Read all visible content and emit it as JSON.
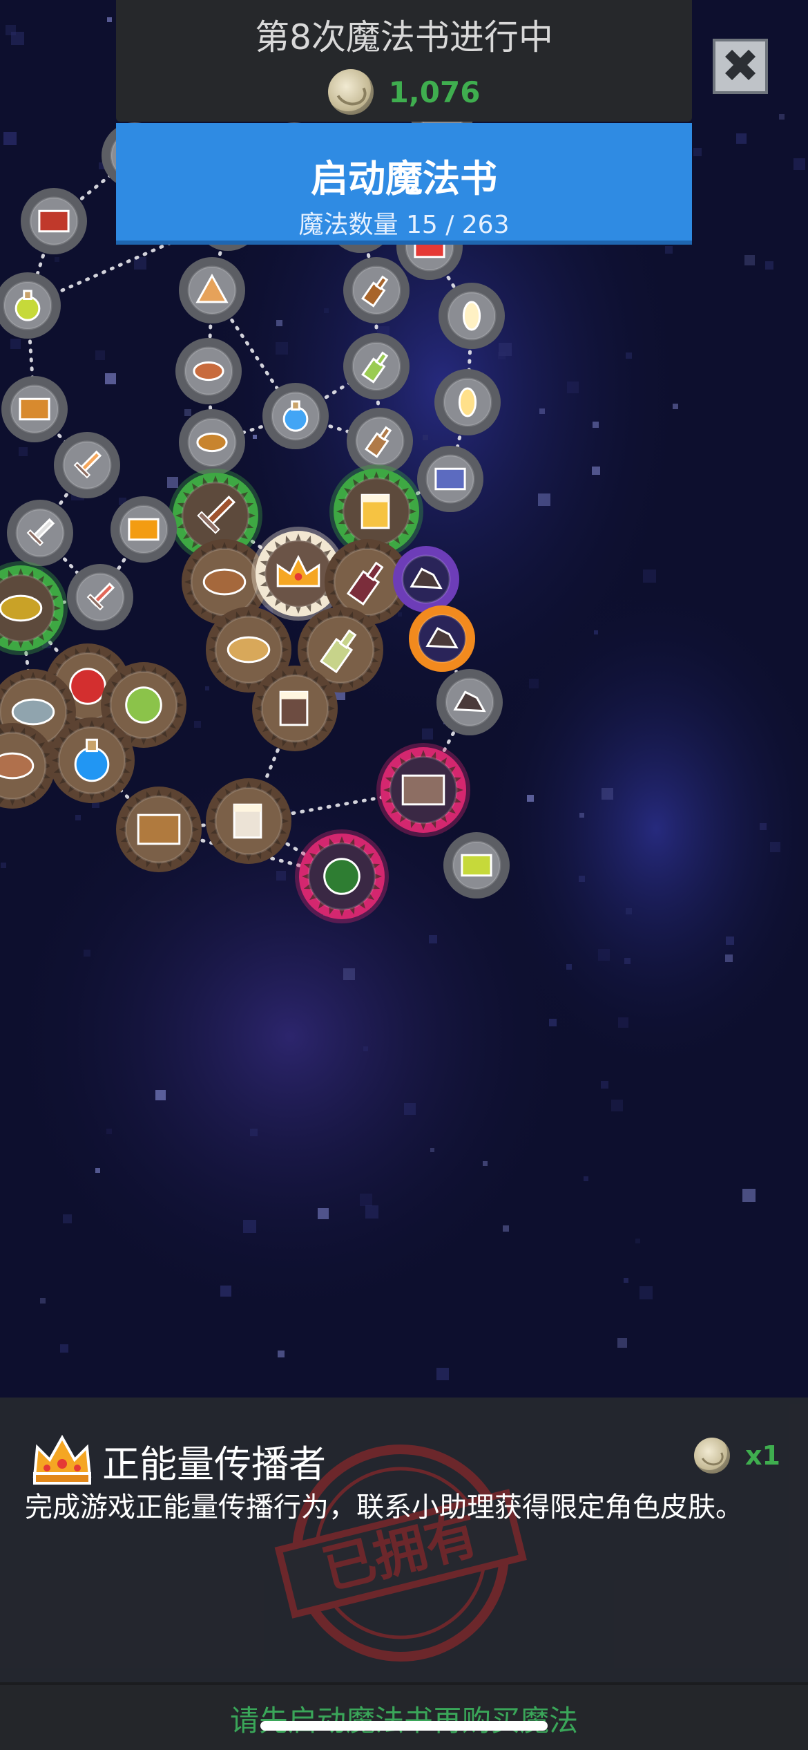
{
  "header": {
    "title": "第8次魔法书进行中",
    "coins": "1,076",
    "close_icon": "close-icon"
  },
  "start_button": {
    "label": "启动魔法书",
    "magic_count": "魔法数量 15 / 263"
  },
  "selected": {
    "icon": "crown-icon",
    "title": "正能量传播者",
    "cost_quantity": "x1",
    "description": "完成游戏正能量传播行为，联系小助理获得限定角色皮肤。",
    "stamp_text": "已拥有"
  },
  "footer": {
    "message": "请先启动魔法书再购买魔法"
  },
  "colors": {
    "background": "#0d0f2e",
    "accent_blue": "#2f8be3",
    "coin_green": "#3fae4f",
    "owned_bronze": "#6e5540",
    "active_green": "#3ea843",
    "rare_purple": "#6d3db8",
    "epic_orange": "#f28a1e",
    "legend_pink": "#d4276f",
    "locked_grey": "#77797f"
  },
  "nodes": [
    {
      "icon": "bacon-icon",
      "state": "locked"
    },
    {
      "icon": "onigiri-icon",
      "state": "locked"
    },
    {
      "icon": "bottle-icon",
      "state": "locked"
    },
    {
      "icon": "boot-icon",
      "state": "locked"
    },
    {
      "icon": "red-card-icon",
      "state": "locked"
    },
    {
      "icon": "potion-icon",
      "state": "locked"
    },
    {
      "icon": "pizza-icon",
      "state": "locked"
    },
    {
      "icon": "whiskey-icon",
      "state": "locked"
    },
    {
      "icon": "candle-icon",
      "state": "locked"
    },
    {
      "icon": "hotdog-icon",
      "state": "locked"
    },
    {
      "icon": "wine-bottle-icon",
      "state": "locked"
    },
    {
      "icon": "treasure-chest-icon",
      "state": "locked"
    },
    {
      "icon": "blue-potion-icon",
      "state": "locked"
    },
    {
      "icon": "lit-candle-icon",
      "state": "locked"
    },
    {
      "icon": "burger-icon",
      "state": "locked"
    },
    {
      "icon": "rum-bottle-icon",
      "state": "locked"
    },
    {
      "icon": "sword-icon",
      "state": "locked"
    },
    {
      "icon": "winged-boot-icon",
      "state": "locked"
    },
    {
      "icon": "kebab-icon",
      "state": "active"
    },
    {
      "icon": "beer-icon",
      "state": "active"
    },
    {
      "icon": "dagger-icon",
      "state": "locked"
    },
    {
      "icon": "battery-icon",
      "state": "locked"
    },
    {
      "icon": "steak-icon",
      "state": "owned"
    },
    {
      "icon": "crown-icon",
      "state": "selected"
    },
    {
      "icon": "wine-icon",
      "state": "owned"
    },
    {
      "icon": "ore-icon",
      "state": "rare"
    },
    {
      "icon": "slime-icon",
      "state": "active"
    },
    {
      "icon": "red-sword-icon",
      "state": "locked"
    },
    {
      "icon": "ore-icon",
      "state": "epic"
    },
    {
      "icon": "soup-icon",
      "state": "owned"
    },
    {
      "icon": "white-wine-icon",
      "state": "owned"
    },
    {
      "icon": "apple-icon",
      "state": "owned"
    },
    {
      "icon": "cabbage-icon",
      "state": "owned"
    },
    {
      "icon": "fish-icon",
      "state": "owned"
    },
    {
      "icon": "stout-icon",
      "state": "owned"
    },
    {
      "icon": "ore-icon",
      "state": "locked"
    },
    {
      "icon": "ham-icon",
      "state": "owned"
    },
    {
      "icon": "mana-potion-icon",
      "state": "owned"
    },
    {
      "icon": "robot-icon",
      "state": "legend"
    },
    {
      "icon": "book-icon",
      "state": "owned"
    },
    {
      "icon": "coffee-icon",
      "state": "owned"
    },
    {
      "icon": "glasses-icon",
      "state": "locked"
    },
    {
      "icon": "milk-icon",
      "state": "locked"
    },
    {
      "icon": "red-book-icon",
      "state": "locked"
    },
    {
      "icon": "leaf-icon",
      "state": "legend"
    },
    {
      "icon": "gift-icon",
      "state": "locked"
    }
  ]
}
